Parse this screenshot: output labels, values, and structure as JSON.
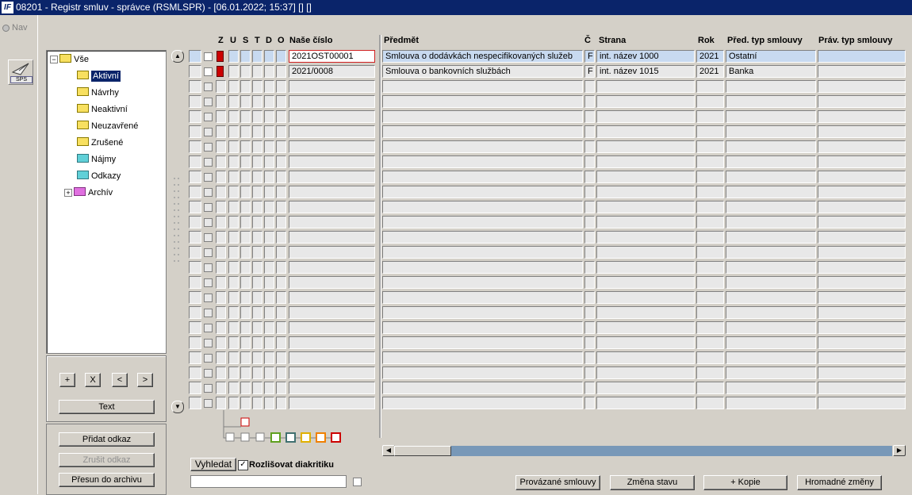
{
  "window": {
    "title": "08201 - Registr smluv - správce (RSMLSPR) - [06.01.2022; 15:37] [] []"
  },
  "leftbar": {
    "nav_label": "Nav",
    "sps_label": "SPS"
  },
  "tree": {
    "root": "Vše",
    "items": [
      {
        "label": "Aktivní",
        "selected": true,
        "color": "yellow"
      },
      {
        "label": "Návrhy",
        "color": "yellow"
      },
      {
        "label": "Neaktivní",
        "color": "yellow"
      },
      {
        "label": "Neuzavřené",
        "color": "yellow"
      },
      {
        "label": "Zrušené",
        "color": "yellow"
      },
      {
        "label": "Nájmy",
        "color": "cyan"
      },
      {
        "label": "Odkazy",
        "color": "cyan"
      },
      {
        "label": "Archív",
        "color": "magenta"
      }
    ]
  },
  "tree_buttons": {
    "add": "+",
    "remove": "X",
    "prev": "<",
    "next": ">",
    "text": "Text"
  },
  "link_buttons": {
    "add_link": "Přidat odkaz",
    "remove_link": "Zrušit odkaz",
    "move_archive": "Přesun do archivu"
  },
  "columns": {
    "z": "Z",
    "u": "U",
    "s": "S",
    "t": "T",
    "d": "D",
    "o": "O",
    "nase_cislo": "Naše číslo",
    "predmet": "Předmět",
    "c": "Č",
    "strana": "Strana",
    "rok": "Rok",
    "pred_typ": "Před. typ smlouvy",
    "prav_typ": "Práv. typ smlouvy"
  },
  "rows": [
    {
      "nase_cislo": "2021OST00001",
      "predmet": "Smlouva o dodávkách nespecifikovaných služeb",
      "c": "F",
      "strana": "int. název 1000",
      "rok": "2021",
      "pred_typ": "Ostatní",
      "prav_typ": ""
    },
    {
      "nase_cislo": "2021/0008",
      "predmet": "Smlouva o bankovních službách",
      "c": "F",
      "strana": "int. název 1015",
      "rok": "2021",
      "pred_typ": "Banka",
      "prav_typ": ""
    }
  ],
  "search": {
    "button": "Vyhledat",
    "diacritics_label": "Rozlišovat diakritiku",
    "diacritics_checked": true,
    "value": ""
  },
  "actions": {
    "linked": "Provázané smlouvy",
    "change_state": "Změna stavu",
    "copy": "+ Kopie",
    "bulk": "Hromadné změny"
  },
  "colors": {
    "titlebar": "#0a246a",
    "selected_row": "#c8daf0",
    "status_red": "#cc0000"
  }
}
